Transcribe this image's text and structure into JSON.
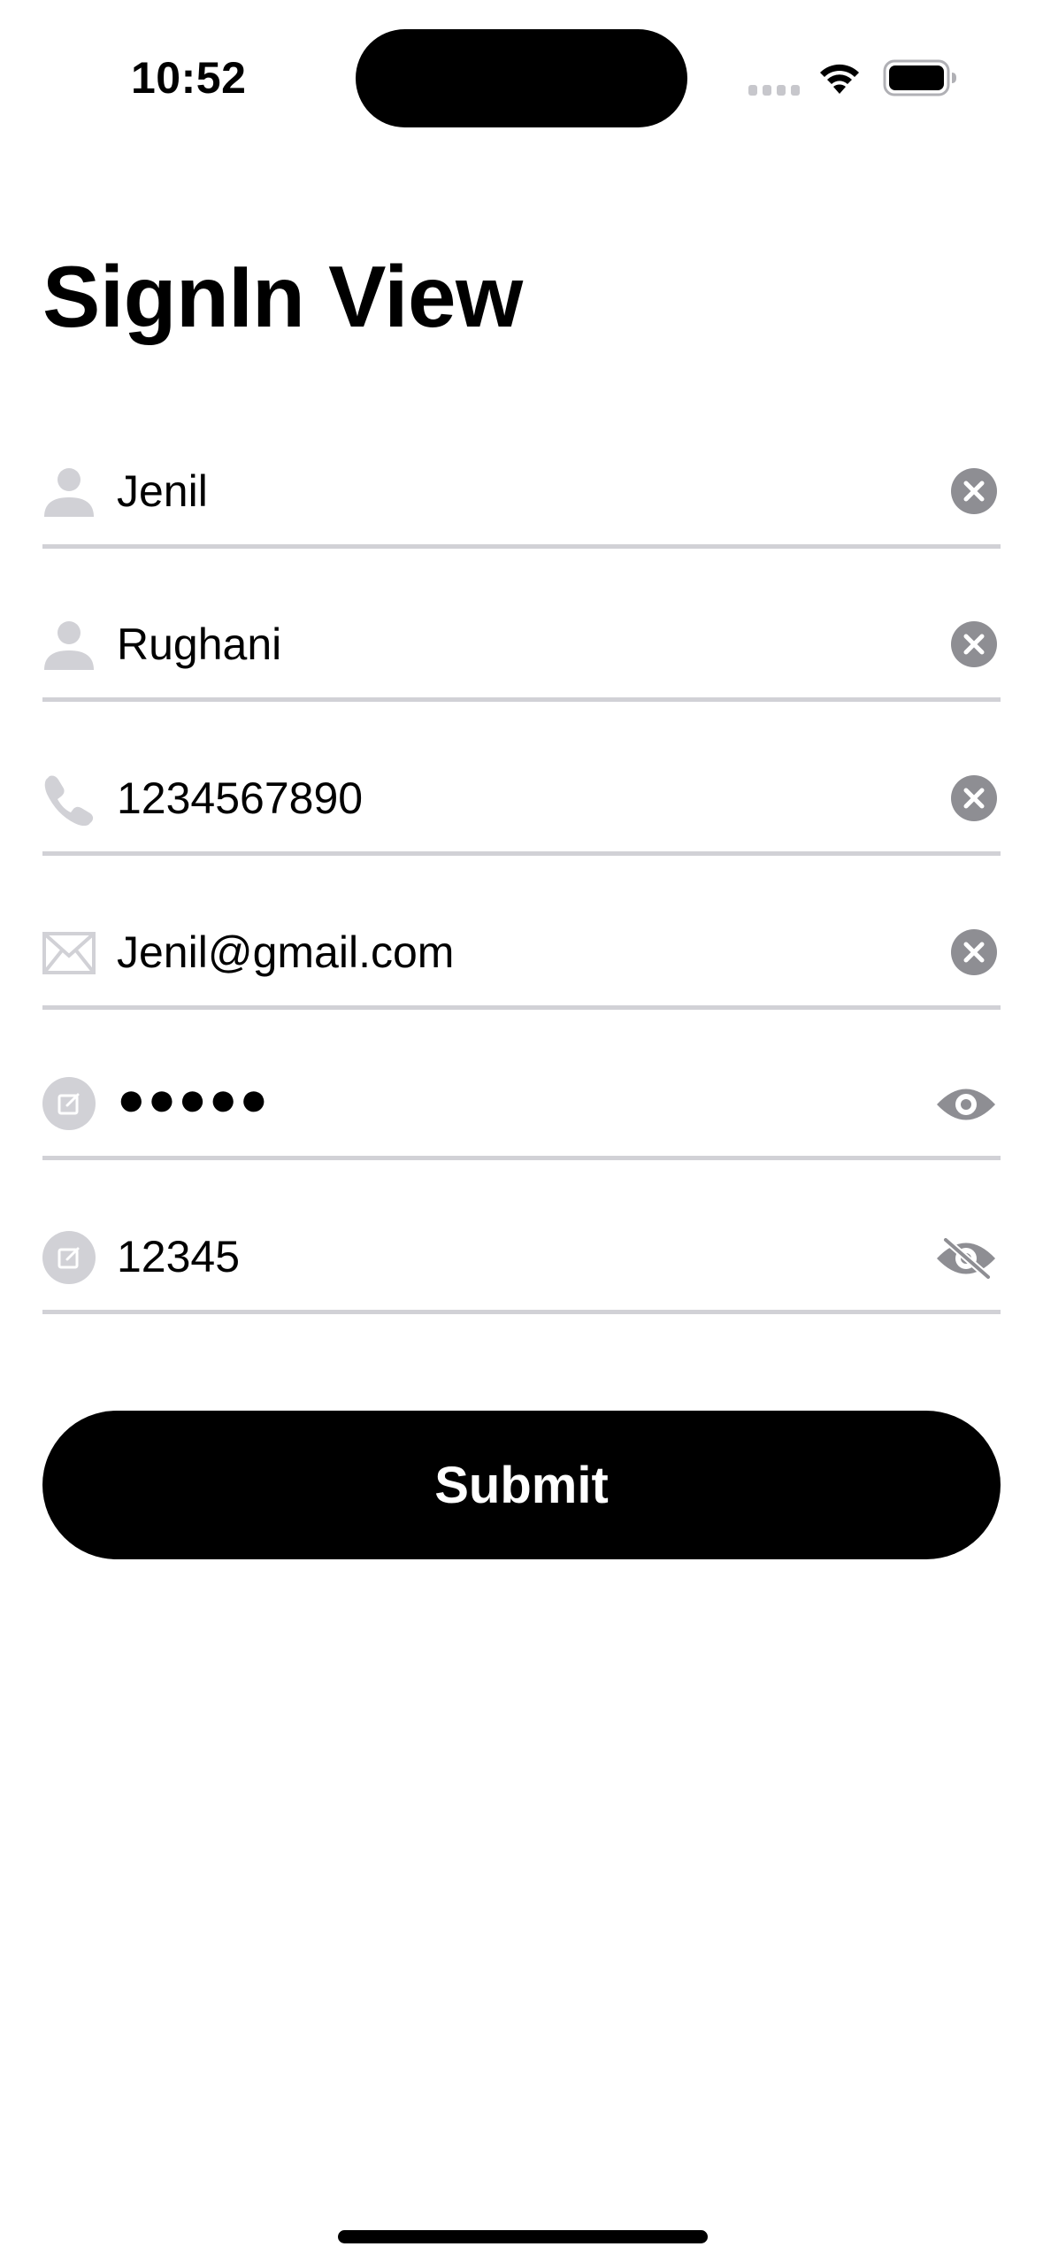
{
  "status_bar": {
    "time": "10:52"
  },
  "title": "SignIn View",
  "fields": [
    {
      "name": "first-name",
      "icon": "person-icon",
      "value": "Jenil",
      "trailing_icon": "clear-icon"
    },
    {
      "name": "last-name",
      "icon": "person-icon",
      "value": "Rughani",
      "trailing_icon": "clear-icon"
    },
    {
      "name": "phone",
      "icon": "phone-icon",
      "value": "1234567890",
      "trailing_icon": "clear-icon"
    },
    {
      "name": "email",
      "icon": "envelope-icon",
      "value": "Jenil@gmail.com",
      "trailing_icon": "clear-icon"
    },
    {
      "name": "password",
      "icon": "edit-icon",
      "value": "●●●●●",
      "trailing_icon": "eye-icon"
    },
    {
      "name": "confirm-password",
      "icon": "edit-icon",
      "value": "12345",
      "trailing_icon": "eye-slash-icon"
    }
  ],
  "submit_label": "Submit",
  "colors": {
    "accent": "#000000",
    "icon_gray": "#8e8e93",
    "icon_light": "#d1d1d6",
    "divider": "#d1d1d6"
  }
}
